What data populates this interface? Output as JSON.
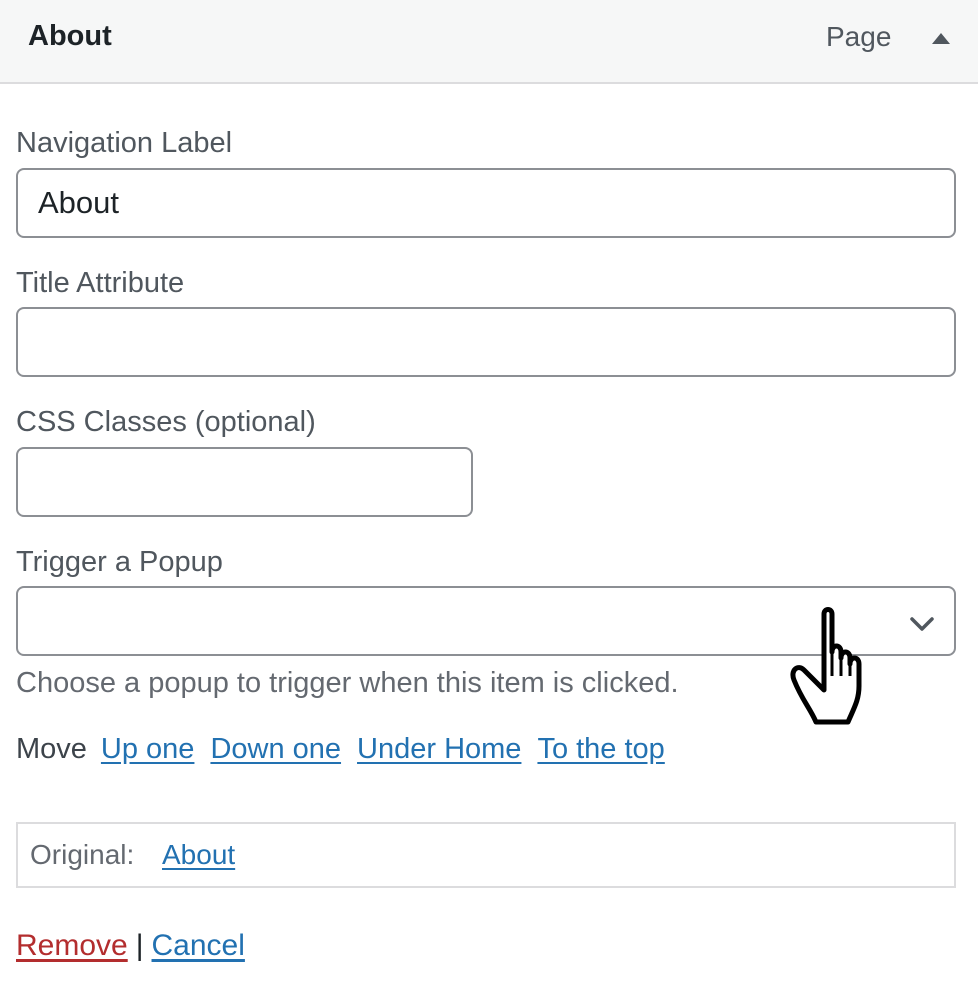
{
  "header": {
    "title": "About",
    "item_type": "Page",
    "toggle_icon": "triangle-up-icon"
  },
  "fields": {
    "navigation_label": {
      "label": "Navigation Label",
      "value": "About"
    },
    "title_attribute": {
      "label": "Title Attribute",
      "value": ""
    },
    "css_classes": {
      "label": "CSS Classes (optional)",
      "value": ""
    },
    "trigger_popup": {
      "label": "Trigger a Popup",
      "selected": "",
      "help": "Choose a popup to trigger when this item is clicked.",
      "icon": "chevron-down-icon"
    }
  },
  "move": {
    "label": "Move",
    "links": [
      "Up one",
      "Down one",
      "Under Home",
      "To the top"
    ]
  },
  "original": {
    "label": "Original:",
    "link": "About"
  },
  "actions": {
    "remove": "Remove",
    "separator": "|",
    "cancel": "Cancel"
  },
  "pointer": {
    "icon": "hand-pointer-icon"
  },
  "colors": {
    "link": "#2271b1",
    "danger": "#b32d2e",
    "header_bg": "#f6f7f7",
    "input_border": "#8c8f94"
  }
}
